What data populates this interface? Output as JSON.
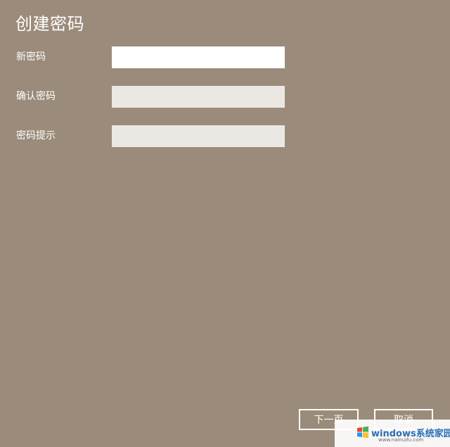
{
  "dialog": {
    "title": "创建密码"
  },
  "form": {
    "fields": [
      {
        "label": "新密码",
        "value": ""
      },
      {
        "label": "确认密码",
        "value": ""
      },
      {
        "label": "密码提示",
        "value": ""
      }
    ]
  },
  "buttons": {
    "next_label": "下一页",
    "cancel_label": "取消"
  },
  "watermark": {
    "brand": "windows系统家园",
    "url": "www.nainuifu.com",
    "icon": "windows-logo-icon"
  },
  "colors": {
    "background": "#9b8b7a",
    "active_field": "#ffffff",
    "inactive_field": "#ebe8e4",
    "text": "#ffffff"
  }
}
